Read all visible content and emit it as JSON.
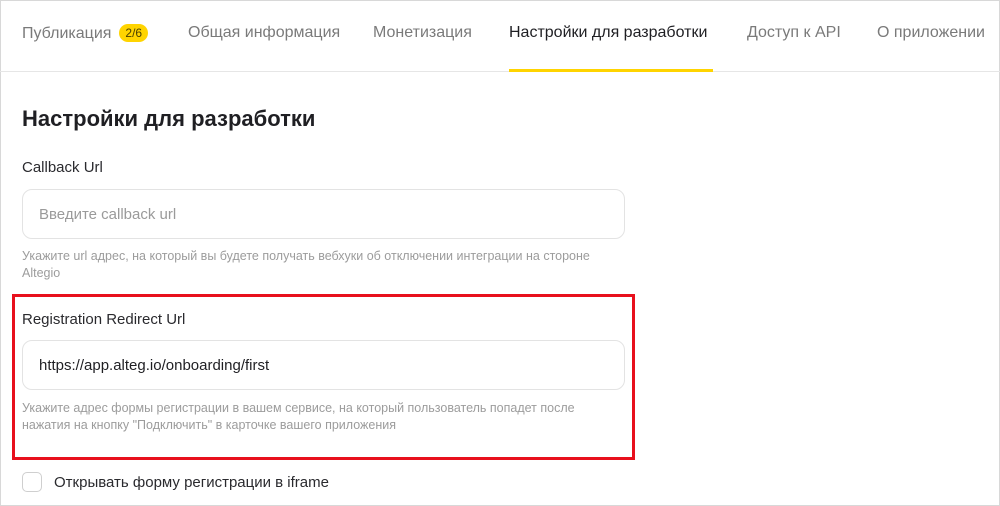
{
  "tabs": [
    {
      "label": "Публикация",
      "badge": "2/6",
      "active": false
    },
    {
      "label": "Общая информация",
      "active": false
    },
    {
      "label": "Монетизация",
      "active": false
    },
    {
      "label": "Настройки для разработки",
      "active": true
    },
    {
      "label": "Доступ к API",
      "active": false
    },
    {
      "label": "О приложении",
      "active": false
    }
  ],
  "page": {
    "title": "Настройки для разработки"
  },
  "callback": {
    "label": "Callback Url",
    "placeholder": "Введите callback url",
    "value": "",
    "hint": "Укажите url адрес, на который вы будете получать вебхуки об отключении интеграции на стороне Altegio"
  },
  "redirect": {
    "label": "Registration Redirect Url",
    "value": "https://app.alteg.io/onboarding/first",
    "hint": "Укажите адрес формы регистрации в вашем сервисе, на который пользователь попадет после нажатия на кнопку \"Подключить\" в карточке вашего приложения"
  },
  "iframe_option": {
    "label": "Открывать форму регистрации в iframe",
    "checked": false
  },
  "colors": {
    "accent": "#ffd400",
    "highlight": "#e8101d"
  }
}
